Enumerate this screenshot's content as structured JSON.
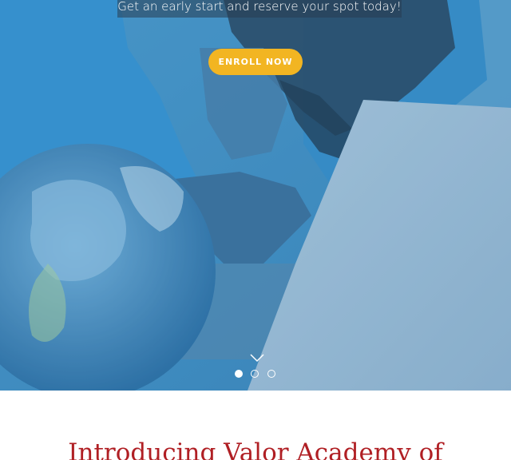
{
  "hero": {
    "tagline": "Get an early start and reserve your spot today!",
    "enroll_label": "ENROLL NOW",
    "scroll_icon": "chevron-down-icon",
    "slides": {
      "count": 3,
      "active_index": 0
    }
  },
  "intro": {
    "title": "Introducing Valor Academy of"
  },
  "colors": {
    "accent": "#f2b522",
    "hero_tint": "#3f8fc4",
    "title_red": "#b01f24"
  }
}
